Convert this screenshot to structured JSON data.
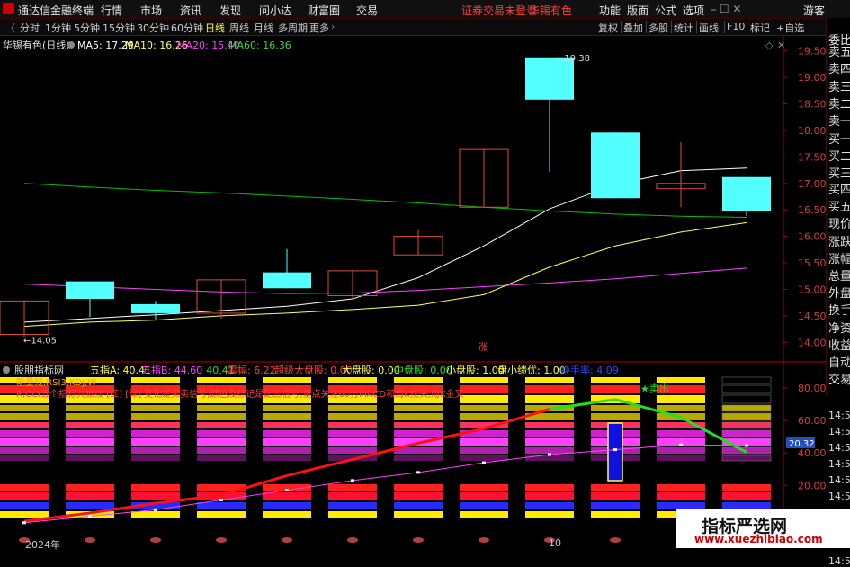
{
  "menubar": {
    "app_title": "通达信金融终端",
    "items": [
      "行情",
      "市场",
      "资讯",
      "发现",
      "问小达",
      "财富圈",
      "交易"
    ],
    "status_red": "证券交易未登录",
    "stock_red": "华锡有色",
    "right_items": [
      "功能",
      "版面",
      "公式",
      "选项"
    ],
    "guest": "游客"
  },
  "periodbar": {
    "periods": [
      "分时",
      "1分钟",
      "5分钟",
      "15分钟",
      "30分钟",
      "60分钟",
      "日线",
      "周线",
      "月线",
      "多周期",
      "更多"
    ],
    "active": "日线",
    "right_buttons": [
      "复权",
      "叠加",
      "多股",
      "统计",
      "画线",
      "F10",
      "标记",
      "+自选"
    ]
  },
  "main_legend": {
    "name": "华锡有色(日线)",
    "ma5": "MA5: 17.29",
    "ma10": "MA10: 16.26",
    "ma20": "MA20: 15.40",
    "ma60": "MA60: 16.36"
  },
  "sub_legend": {
    "name": "股朋指标网",
    "five_a": "五指A: 40.41",
    "five_b": "五指B: 44.60",
    "five_c": ": 40.41",
    "shock": "震幅: 6.22",
    "super": "超级大盘股: 0.00",
    "large": "大盘股: 0.00",
    "mid": "中盘股: 0.00",
    "small": "小盘股: 1.00",
    "perf": "盘小绩优: 1.00",
    "turnover": "换手率: 4.09",
    "desc1": "能量线,RSI3,KDJ,W",
    "desc2": "R,CCI五个指标共振线 [红] [绿] 变化是买卖信号,颜色及标记是配合信号,重点关注60分MACD和周K拐头,周K金叉",
    "sell_label": "★卖出",
    "current_val": "20.32"
  },
  "low_label": "←14.05",
  "high_label": "←19.38",
  "zhang": "涨",
  "right_panel": [
    "委比",
    "卖五",
    "卖四",
    "卖三",
    "卖二",
    "卖一",
    "买一",
    "买二",
    "买三",
    "买四",
    "买五",
    "现价",
    "涨跌",
    "涨幅",
    "总量",
    "外盘",
    "换手",
    "净资",
    "收益",
    "自动",
    "交易"
  ],
  "time_prefix": "14:5",
  "bottom_labels": {
    "year": "2024年",
    "month": "10"
  },
  "watermark": {
    "title": "指标严选网",
    "url": "www.xuezhibiao.com"
  },
  "colors": {
    "up": "#ff4040",
    "down": "#54ffff",
    "ma5": "#ffffff",
    "ma10": "#ffff60",
    "ma20": "#ff40ff",
    "ma60": "#00c000",
    "axis": "#b00000"
  },
  "chart_data": [
    {
      "type": "candlestick",
      "title": "华锡有色(日线)",
      "ylim": [
        13.75,
        19.75
      ],
      "y_ticks": [
        "14.00",
        "14.50",
        "15.00",
        "15.50",
        "16.00",
        "16.50",
        "17.00",
        "17.50",
        "18.00",
        "18.50",
        "19.00",
        "19.50"
      ],
      "candles": [
        {
          "o": 14.15,
          "c": 14.78,
          "h": 14.78,
          "l": 14.1,
          "dir": "up"
        },
        {
          "o": 15.15,
          "c": 14.82,
          "h": 15.15,
          "l": 14.48,
          "dir": "down"
        },
        {
          "o": 14.72,
          "c": 14.55,
          "h": 14.78,
          "l": 14.42,
          "dir": "down"
        },
        {
          "o": 14.55,
          "c": 15.18,
          "h": 15.18,
          "l": 14.45,
          "dir": "up"
        },
        {
          "o": 15.32,
          "c": 15.02,
          "h": 15.76,
          "l": 15.02,
          "dir": "down"
        },
        {
          "o": 14.88,
          "c": 15.35,
          "h": 15.35,
          "l": 14.8,
          "dir": "up"
        },
        {
          "o": 15.65,
          "c": 16.0,
          "h": 16.12,
          "l": 15.65,
          "dir": "up"
        },
        {
          "o": 16.55,
          "c": 17.64,
          "h": 17.64,
          "l": 16.55,
          "dir": "up"
        },
        {
          "o": 19.38,
          "c": 18.58,
          "h": 19.38,
          "l": 17.22,
          "dir": "down"
        },
        {
          "o": 17.96,
          "c": 16.72,
          "h": 17.96,
          "l": 16.72,
          "dir": "down"
        },
        {
          "o": 16.9,
          "c": 17.0,
          "h": 17.78,
          "l": 16.55,
          "dir": "up"
        },
        {
          "o": 17.12,
          "c": 16.48,
          "h": 17.12,
          "l": 16.38,
          "dir": "down"
        }
      ],
      "ma5": [
        14.38,
        14.45,
        14.52,
        14.6,
        14.68,
        14.82,
        15.22,
        15.82,
        16.52,
        16.98,
        17.24,
        17.29
      ],
      "ma10": [
        14.3,
        14.38,
        14.42,
        14.5,
        14.55,
        14.62,
        14.7,
        14.9,
        15.42,
        15.82,
        16.08,
        16.26
      ],
      "ma20": [
        15.1,
        15.05,
        15.0,
        14.95,
        14.92,
        14.93,
        14.98,
        15.05,
        15.12,
        15.2,
        15.3,
        15.4
      ],
      "ma60": [
        17.0,
        16.93,
        16.87,
        16.82,
        16.76,
        16.7,
        16.63,
        16.55,
        16.48,
        16.42,
        16.38,
        16.36
      ]
    },
    {
      "type": "line",
      "title": "股朋指标网",
      "ylim": [
        -12,
        95
      ],
      "y_ticks": [
        "0.00",
        "20.00",
        "40.00",
        "60.00",
        "80.00"
      ],
      "series": [
        {
          "name": "五指A",
          "color": "#ff1010",
          "values": [
            -2,
            3,
            9,
            14,
            26,
            36,
            46,
            55,
            67,
            73,
            62,
            40.41
          ]
        },
        {
          "name": "五指B",
          "color": "#ff40ff",
          "values": [
            -3,
            1,
            5,
            11,
            17,
            23,
            28,
            34,
            39,
            42,
            45,
            44.6
          ]
        }
      ],
      "sell_marker_index": 9
    }
  ]
}
